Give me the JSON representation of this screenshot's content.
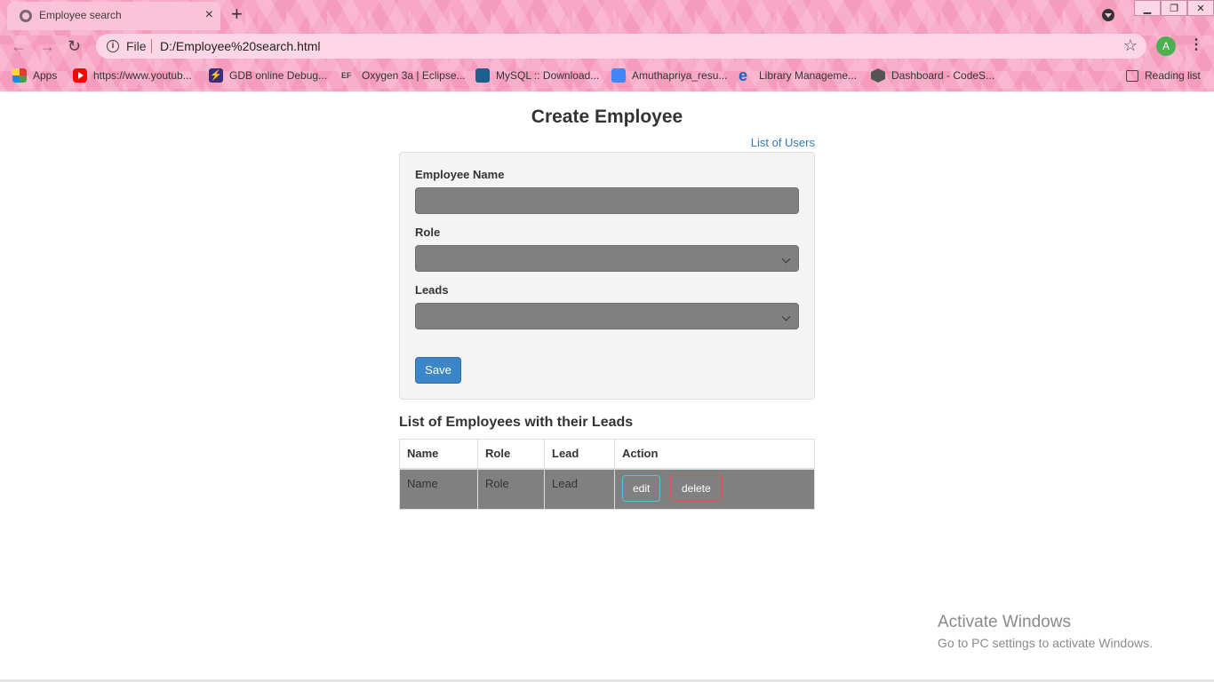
{
  "browser": {
    "tab_title": "Employee search",
    "tab_close": "×",
    "new_tab": "+",
    "address": {
      "scheme_label": "File",
      "url": "D:/Employee%20search.html"
    },
    "profile_initial": "A",
    "bookmarks": [
      {
        "label": "Apps",
        "icon": "apps-icon"
      },
      {
        "label": "https://www.youtub...",
        "icon": "youtube-icon"
      },
      {
        "label": "GDB online Debug...",
        "icon": "gdb-icon"
      },
      {
        "label": "Oxygen 3a | Eclipse...",
        "icon": "eclipse-icon"
      },
      {
        "label": "MySQL :: Download...",
        "icon": "mysql-icon"
      },
      {
        "label": "Amuthapriya_resu...",
        "icon": "docs-icon"
      },
      {
        "label": "Library Manageme...",
        "icon": "e-icon"
      },
      {
        "label": "Dashboard - CodeS...",
        "icon": "codesandbox-icon"
      }
    ],
    "reading_list": "Reading list"
  },
  "page": {
    "title": "Create Employee",
    "list_link": "List of Users",
    "form": {
      "name_label": "Employee Name",
      "name_value": "",
      "role_label": "Role",
      "role_selected": "",
      "leads_label": "Leads",
      "leads_selected": "",
      "save_label": "Save"
    },
    "list_heading": "List of Employees with their Leads",
    "table": {
      "headers": [
        "Name",
        "Role",
        "Lead",
        "Action"
      ],
      "rows": [
        {
          "name": "Name",
          "role": "Role",
          "lead": "Lead",
          "edit_label": "edit",
          "delete_label": "delete"
        }
      ]
    }
  },
  "watermark": {
    "title": "Activate Windows",
    "subtitle": "Go to PC settings to activate Windows."
  },
  "colors": {
    "chrome_pink": "#f8a8c6",
    "link_blue": "#337ab7",
    "primary_button": "#3a86c8",
    "field_gray": "#808080",
    "edit_border": "#5bc0de",
    "delete_border": "#d9534f"
  }
}
